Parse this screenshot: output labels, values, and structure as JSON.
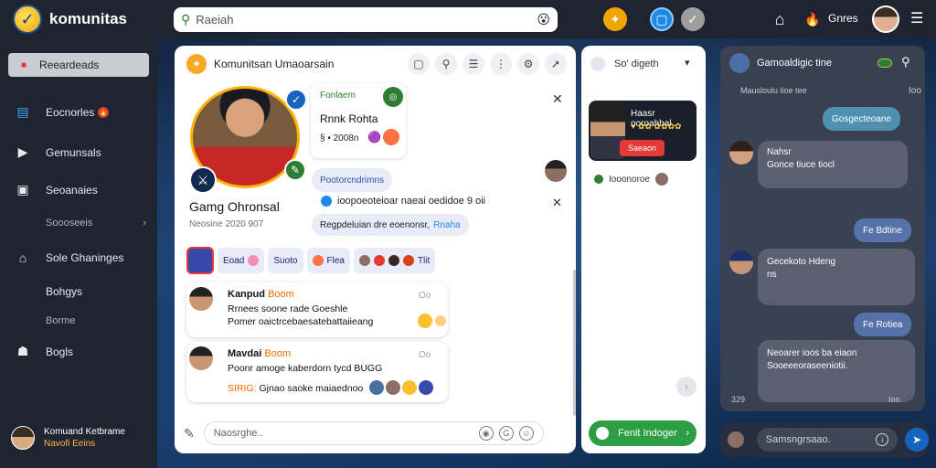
{
  "app": {
    "brand": "komunitas",
    "search_placeholder": "Raeiah"
  },
  "topbar": {
    "games_label": "Gnres"
  },
  "sidebar": {
    "items": [
      {
        "label": "Reeardeads",
        "icon": "badge-icon"
      },
      {
        "label": "Eocnorles",
        "icon": "grid-icon",
        "badge": "🔥"
      },
      {
        "label": "Gemunsals",
        "icon": "play-icon"
      },
      {
        "label": "Seoanaies",
        "icon": "document-icon"
      },
      {
        "label": "Soooseeis",
        "icon": "chevron-right-icon"
      },
      {
        "label": "Sole Ghaninges",
        "icon": "home-icon"
      },
      {
        "label": "Bohgys",
        "icon": ""
      },
      {
        "label": "Borme",
        "icon": ""
      },
      {
        "label": "Bogls",
        "icon": "profile-icon"
      }
    ],
    "user": {
      "name": "Komuand Ketbrame",
      "sub": "Navofi Eeins"
    }
  },
  "panel": {
    "title": "Komunitsan Umaoarsain",
    "profile": {
      "name": "Gamg Ohronsal",
      "meta": "Neosine 2020 907"
    },
    "info_card": {
      "label": "Fonlaem",
      "name": "Rnnk Rohta",
      "number": "§ • 2008n"
    },
    "pill_1": "Pootorcndrimns",
    "info_line": "ioopoeoteioar naeai oedidoe 9 oii",
    "pill_2_text": "Regpdeluian dre eoenonsr,",
    "pill_2_link": "Rnaha",
    "chips": [
      "Eoad",
      "Suoto",
      "Flea",
      "Tlit"
    ],
    "posts": [
      {
        "name": "Kanpud",
        "tag": "Boom",
        "time": "Oo",
        "line1": "Rrnees soone rade Goeshle",
        "line2": "Pomer oaictrcebaesatebattaiieang"
      },
      {
        "name": "Mavdai",
        "tag": "Boom",
        "time": "Oo",
        "line1": "Poonr amoge kaberdorn tycd BUGG",
        "line2_prefix": "SIRIG:",
        "line2": "Gjnao saoke maiaednoo"
      }
    ],
    "compose_placeholder": "Naosrghe.."
  },
  "middle": {
    "header": "So' digeth",
    "card": {
      "line1": "Haasr ooroahhal",
      "line2": "♥ ✿✿ ✿✿✿✿",
      "button": "Saeaon"
    },
    "row_label": "Iooonoroe",
    "button": "Fenit Indoger"
  },
  "chat": {
    "title": "Gamoaldigic tine",
    "sub_left": "Mausloulu lioe tee",
    "sub_right": "Ioo",
    "messages": [
      {
        "dir": "out",
        "text": "Gosgecteoane"
      },
      {
        "dir": "in",
        "a": "Nahsr",
        "b": "Gonce tiuce tiocl"
      },
      {
        "dir": "out",
        "text": "Fe Bdtine"
      },
      {
        "dir": "in",
        "a": "Gecekoto  Hdeng",
        "b": "ns"
      },
      {
        "dir": "out",
        "text": "Fe Rotiea"
      },
      {
        "dir": "in",
        "a": "Neoarer ioos ba eiaon",
        "b": "Sooeeeoraseeniotii."
      }
    ],
    "ts_left": "329",
    "ts_right": "Ioo",
    "compose_placeholder": "Samsngrsaao."
  },
  "colors": {
    "accent": "#1e88e5",
    "green": "#2e9e44",
    "dark": "#1f2530",
    "alert": "#e53935"
  }
}
